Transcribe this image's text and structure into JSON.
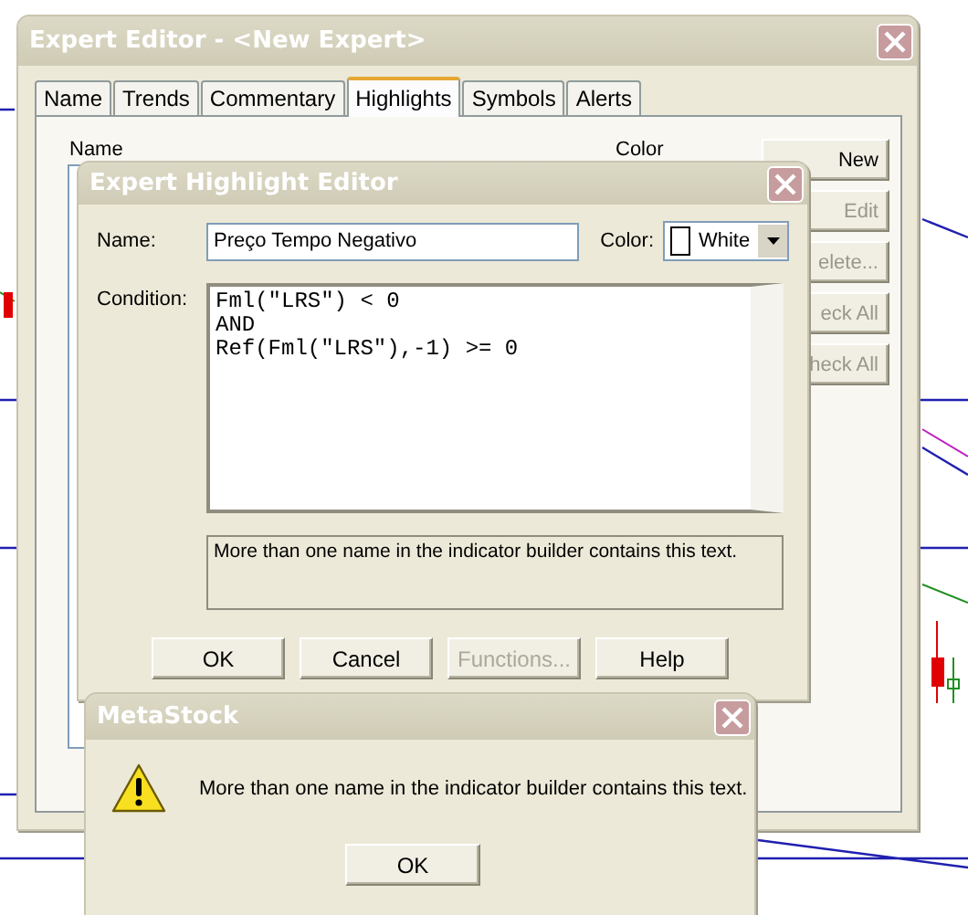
{
  "expert_editor": {
    "title": "Expert Editor - <New Expert>",
    "tabs": [
      {
        "label": "Name",
        "selected": false
      },
      {
        "label": "Trends",
        "selected": false
      },
      {
        "label": "Commentary",
        "selected": false
      },
      {
        "label": "Highlights",
        "selected": true
      },
      {
        "label": "Symbols",
        "selected": false
      },
      {
        "label": "Alerts",
        "selected": false
      }
    ],
    "list_header": {
      "column_1": "Name",
      "column_2": "Color"
    },
    "side_buttons": [
      {
        "label": "New",
        "disabled": false
      },
      {
        "label": "Edit",
        "disabled": true
      },
      {
        "label": "elete...",
        "disabled": true
      },
      {
        "label": "eck All",
        "disabled": true
      },
      {
        "label": "heck All",
        "disabled": true
      }
    ]
  },
  "highlight_editor": {
    "title": "Expert Highlight Editor",
    "name_label": "Name:",
    "name_value": "Preço Tempo Negativo",
    "color_label": "Color:",
    "color_value": "White",
    "condition_label": "Condition:",
    "condition": "Fml(\"LRS\") < 0\nAND\nRef(Fml(\"LRS\"),-1) >= 0",
    "message": "More than one name in the indicator builder contains this text.",
    "buttons": [
      {
        "label": "OK",
        "disabled": false
      },
      {
        "label": "Cancel",
        "disabled": false
      },
      {
        "label": "Functions...",
        "disabled": true
      },
      {
        "label": "Help",
        "disabled": false
      }
    ]
  },
  "message_box": {
    "title": "MetaStock",
    "message": "More than one name in the indicator builder contains this text.",
    "button": "OK"
  }
}
